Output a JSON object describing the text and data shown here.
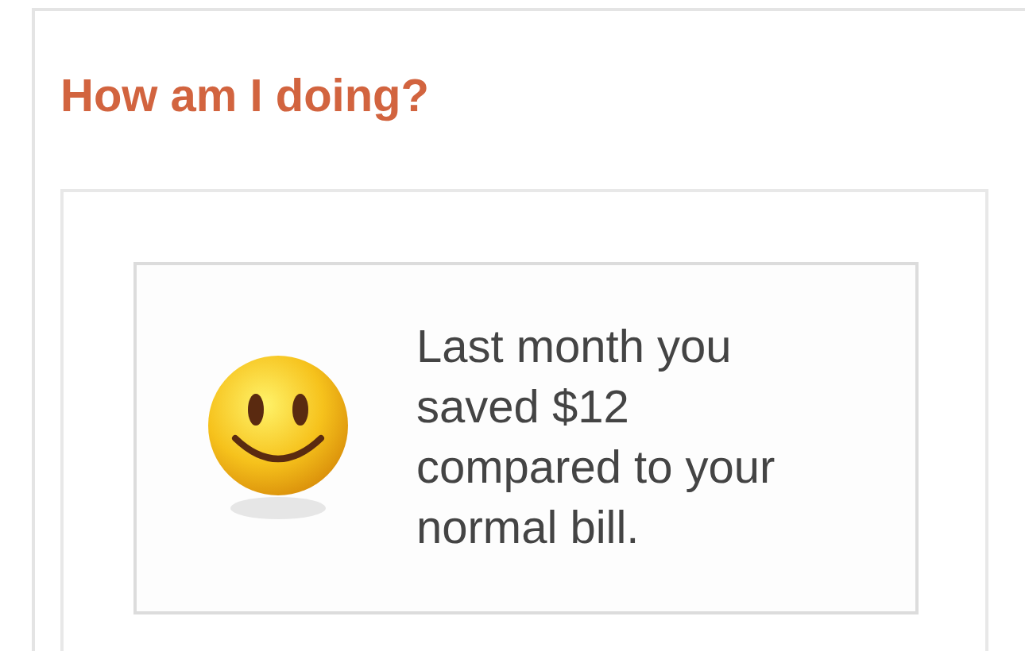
{
  "heading": "How am I doing?",
  "message": {
    "lines": [
      "Last month you",
      "saved $12",
      "compared to your",
      "normal bill."
    ]
  }
}
